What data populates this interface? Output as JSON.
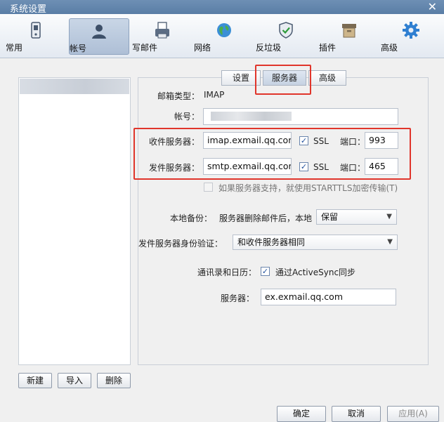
{
  "window": {
    "title": "系统设置",
    "close_glyph": "✕"
  },
  "toolbar": {
    "items": [
      {
        "label": "常用",
        "icon": "phone-icon"
      },
      {
        "label": "帐号",
        "icon": "user-icon"
      },
      {
        "label": "写邮件",
        "icon": "compose-icon"
      },
      {
        "label": "网络",
        "icon": "globe-icon"
      },
      {
        "label": "反垃圾",
        "icon": "shield-icon"
      },
      {
        "label": "插件",
        "icon": "box-icon"
      },
      {
        "label": "高级",
        "icon": "gear-icon"
      }
    ],
    "active": "帐号"
  },
  "subtabs": [
    {
      "label": "设置"
    },
    {
      "label": "服务器"
    },
    {
      "label": "高级"
    }
  ],
  "form": {
    "mail_type_label": "邮箱类型：",
    "mail_type_value": "IMAP",
    "account_label": "帐号：",
    "incoming_label": "收件服务器：",
    "incoming_value": "imap.exmail.qq.com",
    "incoming_ssl_label": "SSL",
    "incoming_port_label": "端口：",
    "incoming_port_value": "993",
    "outgoing_label": "发件服务器：",
    "outgoing_value": "smtp.exmail.qq.com",
    "outgoing_ssl_label": "SSL",
    "outgoing_port_label": "端口：",
    "outgoing_port_value": "465",
    "starttls_label": "如果服务器支持，就使用STARTTLS加密传输(T)",
    "backup_label": "本地备份：",
    "backup_desc": "服务器删除邮件后，本地",
    "backup_value": "保留",
    "auth_label": "发件服务器身份验证：",
    "auth_value": "和收件服务器相同",
    "sync_label": "通讯录和日历：",
    "sync_check_label": "通过ActiveSync同步",
    "server_label": "服务器：",
    "server_value": "ex.exmail.qq.com"
  },
  "account_buttons": {
    "new": "新建",
    "import": "导入",
    "delete": "删除"
  },
  "footer": {
    "ok": "确定",
    "cancel": "取消",
    "apply": "应用(A)"
  },
  "colors": {
    "highlight": "#e0352b",
    "check": "#1f4f9c"
  }
}
